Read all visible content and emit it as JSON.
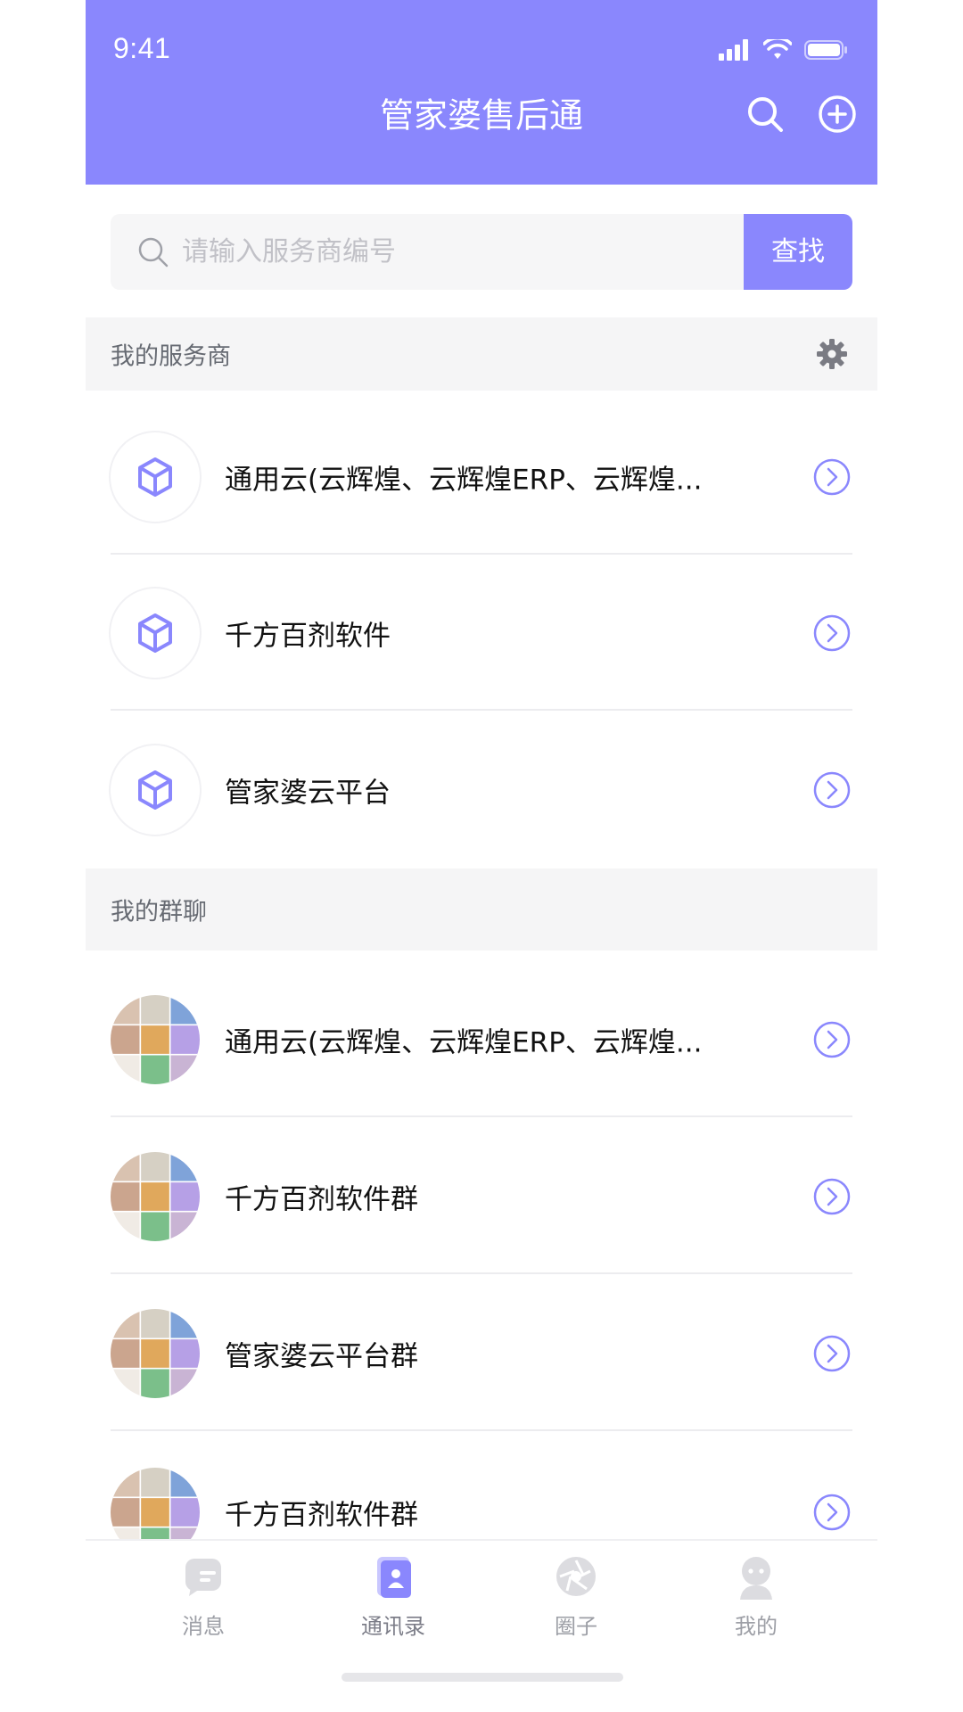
{
  "status_bar": {
    "time": "9:41"
  },
  "header": {
    "title": "管家婆售后通"
  },
  "search": {
    "placeholder": "请输入服务商编号",
    "button_label": "查找"
  },
  "sections": {
    "services": {
      "label": "我的服务商"
    },
    "groups": {
      "label": "我的群聊"
    }
  },
  "services": [
    {
      "name": "通用云(云辉煌、云辉煌ERP、云辉煌..."
    },
    {
      "name": "千方百剂软件"
    },
    {
      "name": "管家婆云平台"
    }
  ],
  "groups": [
    {
      "name": "通用云(云辉煌、云辉煌ERP、云辉煌..."
    },
    {
      "name": "千方百剂软件群"
    },
    {
      "name": "管家婆云平台群"
    },
    {
      "name": "千方百剂软件群"
    }
  ],
  "tabbar": {
    "items": [
      {
        "label": "消息",
        "icon": "message-icon"
      },
      {
        "label": "通讯录",
        "icon": "contacts-icon",
        "active": true
      },
      {
        "label": "圈子",
        "icon": "circle-icon"
      },
      {
        "label": "我的",
        "icon": "profile-icon"
      }
    ]
  },
  "colors": {
    "accent": "#8a87fd",
    "section_bg": "#f5f5f6"
  }
}
